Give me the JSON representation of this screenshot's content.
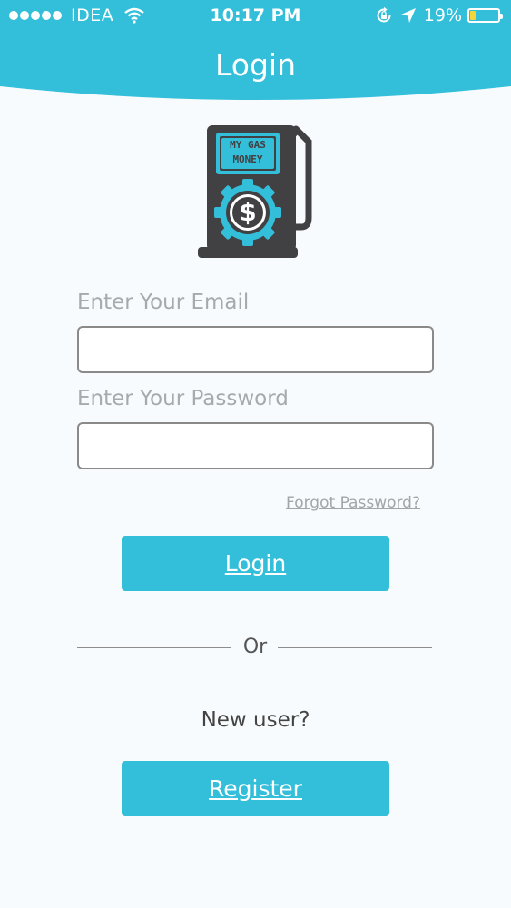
{
  "status_bar": {
    "carrier": "IDEA",
    "time": "10:17 PM",
    "battery_percent": "19%",
    "battery_level": 0.19,
    "icons": [
      "signal-dots-icon",
      "wifi-icon",
      "rotation-lock-icon",
      "location-arrow-icon",
      "battery-icon"
    ]
  },
  "header": {
    "title": "Login",
    "color": "#33bfd9"
  },
  "logo": {
    "text_line1": "MY GAS",
    "text_line2": "MONEY",
    "symbol": "$"
  },
  "form": {
    "email_label": "Enter Your Email",
    "email_value": "",
    "password_label": "Enter Your Password",
    "password_value": "",
    "forgot_password": "Forgot Password?",
    "login_button": "Login"
  },
  "divider": {
    "text": "Or"
  },
  "register": {
    "prompt": "New user?",
    "button": "Register"
  },
  "colors": {
    "accent": "#33bfd9",
    "background": "#f7fbfd",
    "logo_dark": "#414042"
  }
}
